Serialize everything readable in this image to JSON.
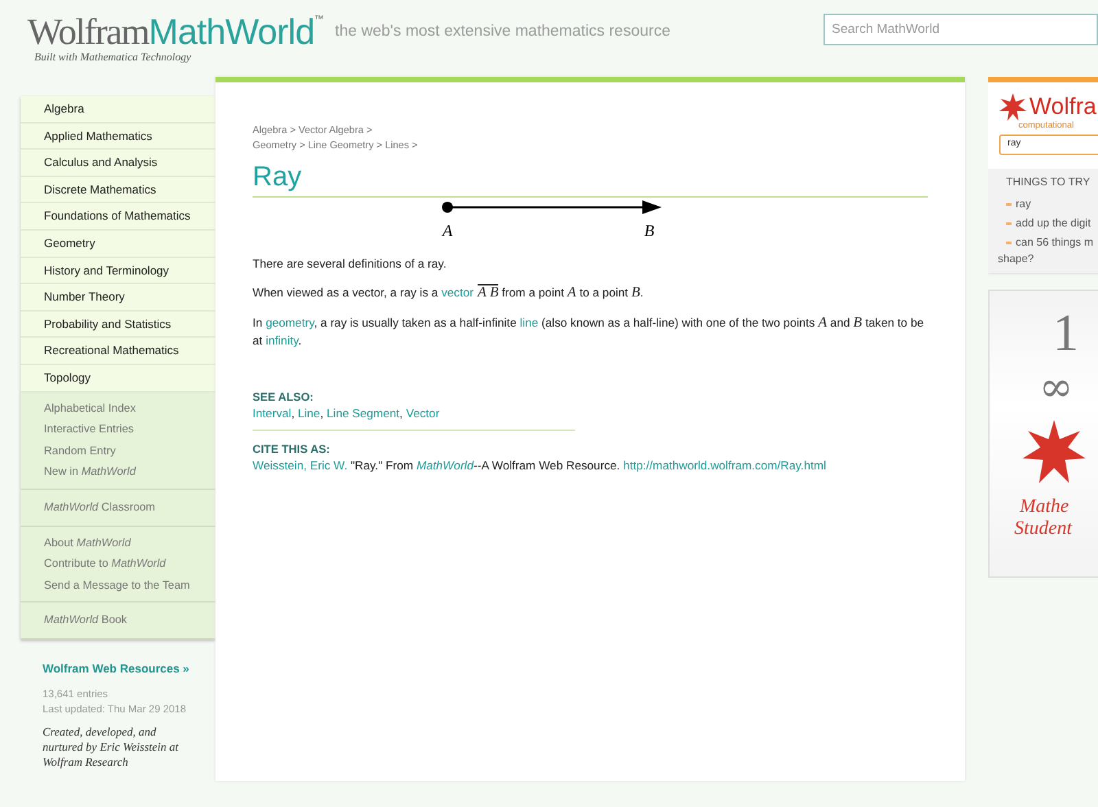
{
  "header": {
    "logo_word": "Wolfram",
    "logo_product": "MathWorld",
    "trademark": "™",
    "logo_subtitle": "Built with Mathematica Technology",
    "tagline": "the web's most extensive mathematics resource",
    "search": {
      "placeholder": "Search MathWorld"
    }
  },
  "sidebar": {
    "groups": [
      {
        "kind": "topics",
        "items": [
          "Algebra",
          "Applied Mathematics",
          "Calculus and Analysis",
          "Discrete Mathematics",
          "Foundations of Mathematics",
          "Geometry",
          "History and Terminology",
          "Number Theory",
          "Probability and Statistics",
          "Recreational Mathematics",
          "Topology"
        ]
      },
      {
        "kind": "links",
        "items": [
          "Alphabetical Index",
          "Interactive Entries",
          "Random Entry",
          "New in *MathWorld*"
        ]
      },
      {
        "kind": "links",
        "items": [
          "*MathWorld* Classroom"
        ]
      },
      {
        "kind": "links",
        "items": [
          "About *MathWorld*",
          "Contribute to *MathWorld*",
          "Send a Message to the Team"
        ]
      },
      {
        "kind": "links",
        "items": [
          "*MathWorld* Book"
        ]
      }
    ],
    "resources_link": "Wolfram Web Resources »",
    "entries": "13,641 entries",
    "updated": "Last updated: Thu Mar 29 2018",
    "credit": "Created, developed, and nurtured by Eric Weisstein at Wolfram Research"
  },
  "article": {
    "breadcrumbs": [
      [
        "Algebra",
        "Vector Algebra"
      ],
      [
        "Geometry",
        "Line Geometry",
        "Lines"
      ]
    ],
    "separator": ">",
    "title": "Ray",
    "diagram": {
      "labels": [
        "A",
        "B"
      ]
    },
    "paragraphs": [
      [
        {
          "kind": "text",
          "text": "There are several definitions of a ray."
        }
      ],
      [
        {
          "kind": "text",
          "text": "When viewed as a vector, a ray is a "
        },
        {
          "kind": "link",
          "text": "vector"
        },
        {
          "kind": "vector",
          "text": "A B"
        },
        {
          "kind": "text",
          "text": " from a point "
        },
        {
          "kind": "math",
          "text": "A"
        },
        {
          "kind": "text",
          "text": " to a point "
        },
        {
          "kind": "math",
          "text": "B"
        },
        {
          "kind": "text",
          "text": "."
        }
      ],
      [
        {
          "kind": "text",
          "text": "In "
        },
        {
          "kind": "link",
          "text": "geometry"
        },
        {
          "kind": "text",
          "text": ", a ray is usually taken as a half-infinite "
        },
        {
          "kind": "link",
          "text": "line"
        },
        {
          "kind": "text",
          "text": " (also known as a half-line) with one of the two points "
        },
        {
          "kind": "math",
          "text": "A"
        },
        {
          "kind": "text",
          "text": " and "
        },
        {
          "kind": "math",
          "text": "B"
        },
        {
          "kind": "text",
          "text": " taken to be at "
        },
        {
          "kind": "link",
          "text": "infinity"
        },
        {
          "kind": "text",
          "text": "."
        }
      ]
    ],
    "see_also": {
      "heading": "SEE ALSO:",
      "links": [
        "Interval",
        "Line",
        "Line Segment",
        "Vector"
      ],
      "separator": ","
    },
    "cite": {
      "heading": "CITE THIS AS:",
      "parts": [
        {
          "kind": "link",
          "text": "Weisstein, Eric W."
        },
        {
          "kind": "text",
          "text": " \"Ray.\" From "
        },
        {
          "kind": "italic-link",
          "text": "MathWorld"
        },
        {
          "kind": "text",
          "text": "--A Wolfram Web Resource. "
        },
        {
          "kind": "link",
          "text": "http://mathworld.wolfram.com/Ray.html"
        }
      ]
    }
  },
  "alpha_panel": {
    "logo": "Wolfra",
    "subtitle": "computational",
    "input": "ray",
    "things_heading": "THINGS TO TRY",
    "examples": [
      "ray",
      "add up the digit",
      "can 56 things m"
    ],
    "example_wrap": "shape?"
  },
  "ad": {
    "rows": [
      "1",
      "∞"
    ],
    "caption": [
      "Mathe",
      "Student"
    ]
  }
}
